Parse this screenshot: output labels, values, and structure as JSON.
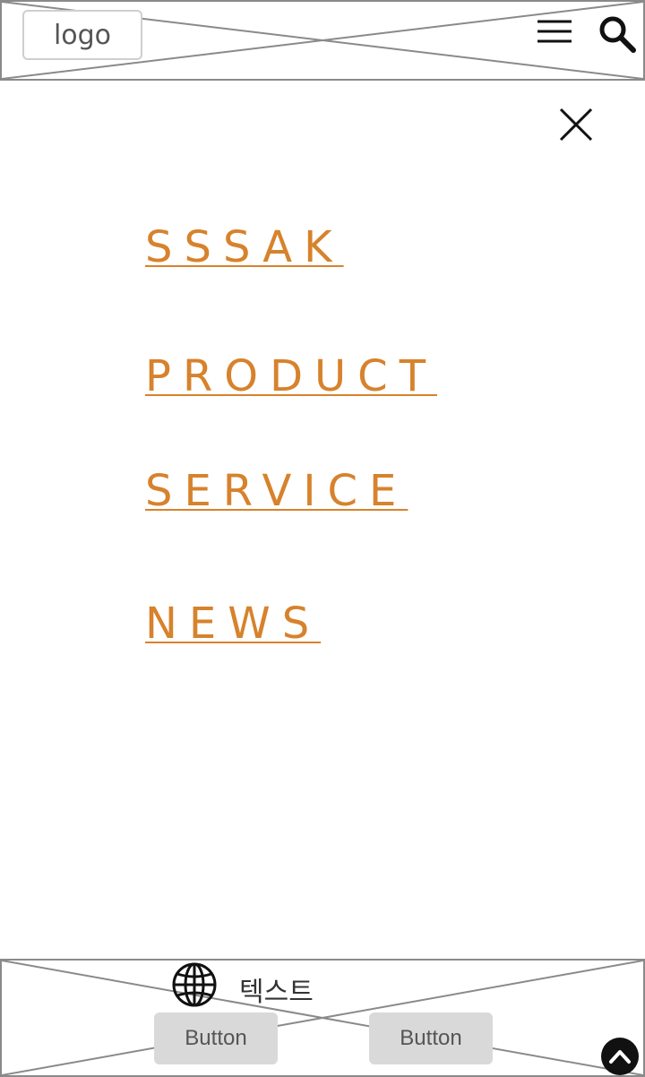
{
  "header": {
    "logo_text": "logo",
    "menu_icon": "hamburger-icon",
    "search_icon": "search-icon"
  },
  "menu": {
    "close_icon": "close-icon",
    "items": [
      {
        "label": "SSSAK"
      },
      {
        "label": "PRODUCT"
      },
      {
        "label": "SERVICE"
      },
      {
        "label": "NEWS"
      }
    ],
    "accent_color": "#d7822c"
  },
  "footer": {
    "globe_icon": "globe-icon",
    "language_text": "텍스트",
    "buttons": [
      {
        "label": "Button"
      },
      {
        "label": "Button"
      }
    ],
    "scroll_top_icon": "chevron-up-icon"
  }
}
